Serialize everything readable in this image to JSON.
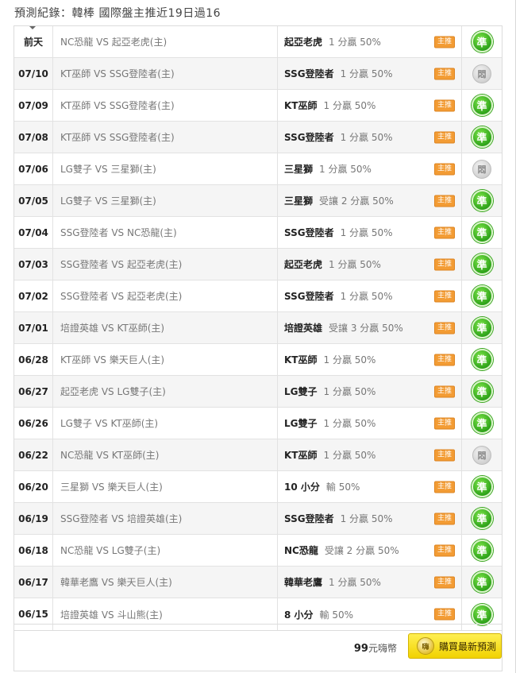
{
  "header": {
    "title": "預測紀錄：",
    "summary": "韓棒 國際盤主推近19日過16"
  },
  "icons": {
    "win": "check-badge-icon",
    "push": "push-badge-icon",
    "tag": "main-pick-tag"
  },
  "rows": [
    {
      "date": "前天",
      "match": "NC恐龍 VS 起亞老虎(主)",
      "team": "起亞老虎",
      "odds": "1 分贏 50%",
      "tag": "主推",
      "result": "準",
      "status": "win"
    },
    {
      "date": "07/10",
      "match": "KT巫師 VS SSG登陸者(主)",
      "team": "SSG登陸者",
      "odds": "1 分贏 50%",
      "tag": "主推",
      "result": "悶",
      "status": "push"
    },
    {
      "date": "07/09",
      "match": "KT巫師 VS SSG登陸者(主)",
      "team": "KT巫師",
      "odds": "1 分贏 50%",
      "tag": "主推",
      "result": "準",
      "status": "win"
    },
    {
      "date": "07/08",
      "match": "KT巫師 VS SSG登陸者(主)",
      "team": "SSG登陸者",
      "odds": "1 分贏 50%",
      "tag": "主推",
      "result": "準",
      "status": "win"
    },
    {
      "date": "07/06",
      "match": "LG雙子 VS 三星獅(主)",
      "team": "三星獅",
      "odds": "1 分贏 50%",
      "tag": "主推",
      "result": "悶",
      "status": "push"
    },
    {
      "date": "07/05",
      "match": "LG雙子 VS 三星獅(主)",
      "team": "三星獅",
      "odds": "受讓 2 分贏 50%",
      "tag": "主推",
      "result": "準",
      "status": "win"
    },
    {
      "date": "07/04",
      "match": "SSG登陸者 VS NC恐龍(主)",
      "team": "SSG登陸者",
      "odds": "1 分贏 50%",
      "tag": "主推",
      "result": "準",
      "status": "win"
    },
    {
      "date": "07/03",
      "match": "SSG登陸者 VS 起亞老虎(主)",
      "team": "起亞老虎",
      "odds": "1 分贏 50%",
      "tag": "主推",
      "result": "準",
      "status": "win"
    },
    {
      "date": "07/02",
      "match": "SSG登陸者 VS 起亞老虎(主)",
      "team": "SSG登陸者",
      "odds": "1 分贏 50%",
      "tag": "主推",
      "result": "準",
      "status": "win"
    },
    {
      "date": "07/01",
      "match": "培證英雄 VS KT巫師(主)",
      "team": "培證英雄",
      "odds": "受讓 3 分贏 50%",
      "tag": "主推",
      "result": "準",
      "status": "win"
    },
    {
      "date": "06/28",
      "match": "KT巫師 VS 樂天巨人(主)",
      "team": "KT巫師",
      "odds": "1 分贏 50%",
      "tag": "主推",
      "result": "準",
      "status": "win"
    },
    {
      "date": "06/27",
      "match": "起亞老虎 VS LG雙子(主)",
      "team": "LG雙子",
      "odds": "1 分贏 50%",
      "tag": "主推",
      "result": "準",
      "status": "win"
    },
    {
      "date": "06/26",
      "match": "LG雙子 VS KT巫師(主)",
      "team": "LG雙子",
      "odds": "1 分贏 50%",
      "tag": "主推",
      "result": "準",
      "status": "win"
    },
    {
      "date": "06/22",
      "match": "NC恐龍 VS KT巫師(主)",
      "team": "KT巫師",
      "odds": "1 分贏 50%",
      "tag": "主推",
      "result": "悶",
      "status": "push"
    },
    {
      "date": "06/20",
      "match": "三星獅 VS 樂天巨人(主)",
      "team": "10 小分",
      "odds": "輸 50%",
      "tag": "主推",
      "result": "準",
      "status": "win"
    },
    {
      "date": "06/19",
      "match": "SSG登陸者 VS 培證英雄(主)",
      "team": "SSG登陸者",
      "odds": "1 分贏 50%",
      "tag": "主推",
      "result": "準",
      "status": "win"
    },
    {
      "date": "06/18",
      "match": "NC恐龍 VS LG雙子(主)",
      "team": "NC恐龍",
      "odds": "受讓 2 分贏 50%",
      "tag": "主推",
      "result": "準",
      "status": "win"
    },
    {
      "date": "06/17",
      "match": "韓華老鷹 VS 樂天巨人(主)",
      "team": "韓華老鷹",
      "odds": "1 分贏 50%",
      "tag": "主推",
      "result": "準",
      "status": "win"
    },
    {
      "date": "06/15",
      "match": "培證英雄 VS 斗山熊(主)",
      "team": "8 小分",
      "odds": "輸 50%",
      "tag": "主推",
      "result": "準",
      "status": "win"
    }
  ],
  "footer": {
    "price_amount": "99",
    "price_unit": "元嗨幣",
    "coin_label": "嗨",
    "buy_label": "購買最新預測"
  }
}
